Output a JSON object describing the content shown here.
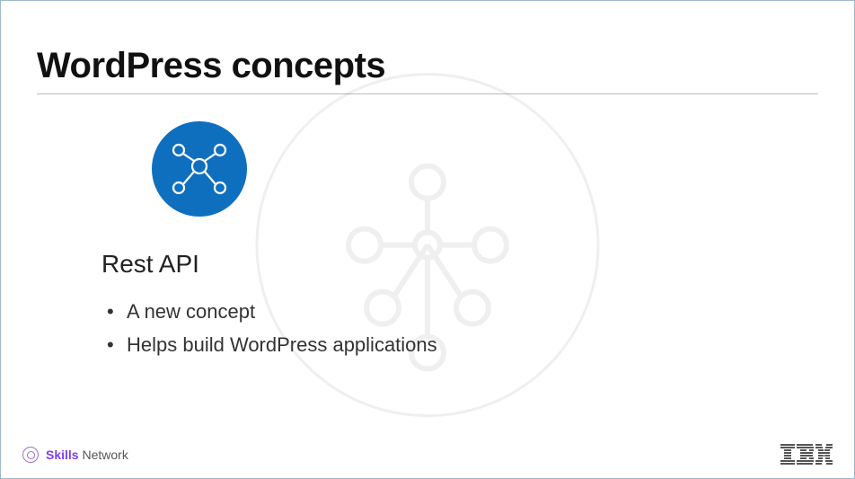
{
  "slide": {
    "title": "WordPress concepts",
    "subheading": "Rest API",
    "bullets": [
      "A new concept",
      "Helps build WordPress applications"
    ]
  },
  "footer": {
    "brand_strong": "Skills",
    "brand_light": "Network"
  },
  "colors": {
    "icon_bg": "#0f6fbf",
    "icon_stroke": "#ffffff",
    "accent": "#7e3ff2"
  }
}
